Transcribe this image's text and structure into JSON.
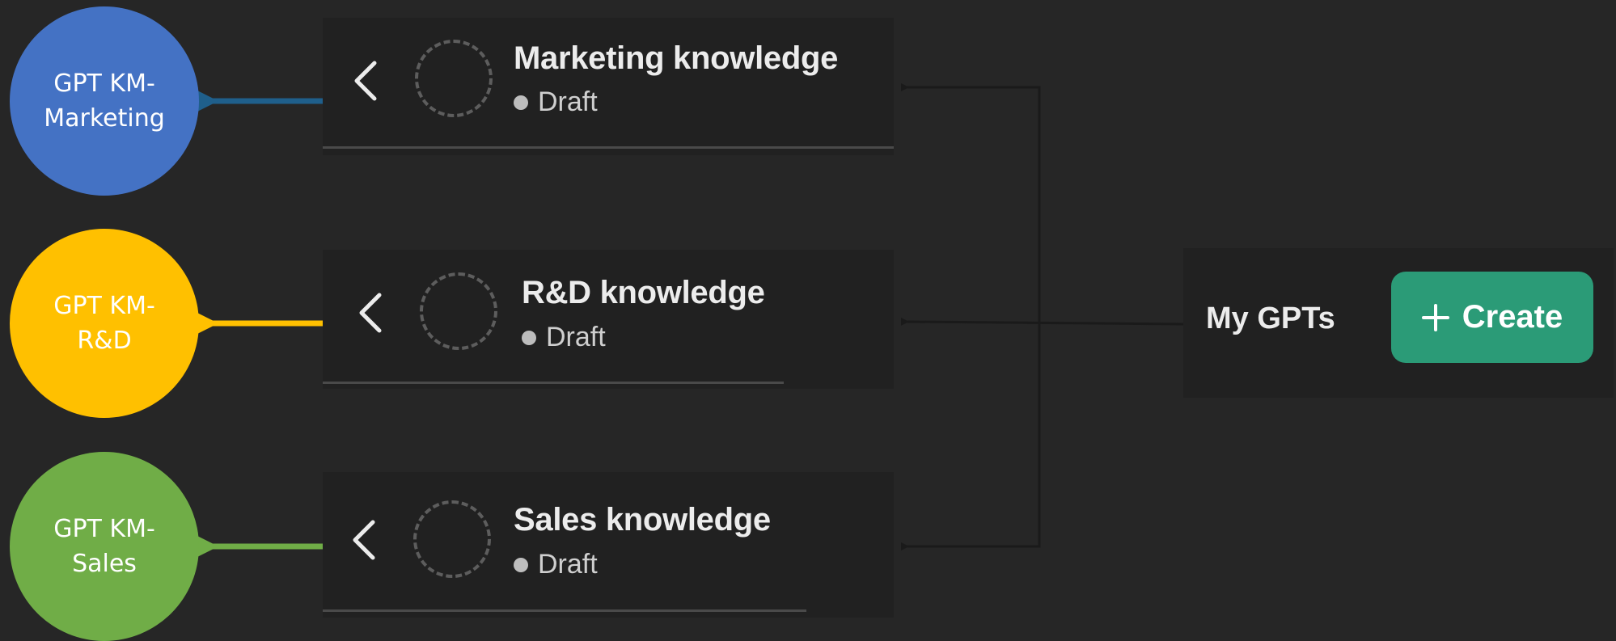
{
  "colors": {
    "background": "#262626",
    "panel": "#212121",
    "accent_create": "#2b9b77",
    "marketing": "#4472c4",
    "rd": "#ffc000",
    "sales": "#70ad47",
    "arrow_marketing": "#1f5f8b"
  },
  "km_nodes": [
    {
      "label": "GPT KM-\nMarketing",
      "color": "#4472c4"
    },
    {
      "label": "GPT KM-\nR&D",
      "color": "#ffc000"
    },
    {
      "label": "GPT KM-\nSales",
      "color": "#70ad47"
    }
  ],
  "gpts": [
    {
      "name": "Marketing knowledge",
      "status": "Draft"
    },
    {
      "name": "R&D knowledge",
      "status": "Draft"
    },
    {
      "name": "Sales knowledge",
      "status": "Draft"
    }
  ],
  "header": {
    "title": "My GPTs",
    "create_label": "Create",
    "create_icon": "plus-icon"
  },
  "icons": {
    "back": "chevron-left-icon",
    "avatar": "dashed-circle-avatar-icon",
    "status": "status-dot-icon"
  }
}
